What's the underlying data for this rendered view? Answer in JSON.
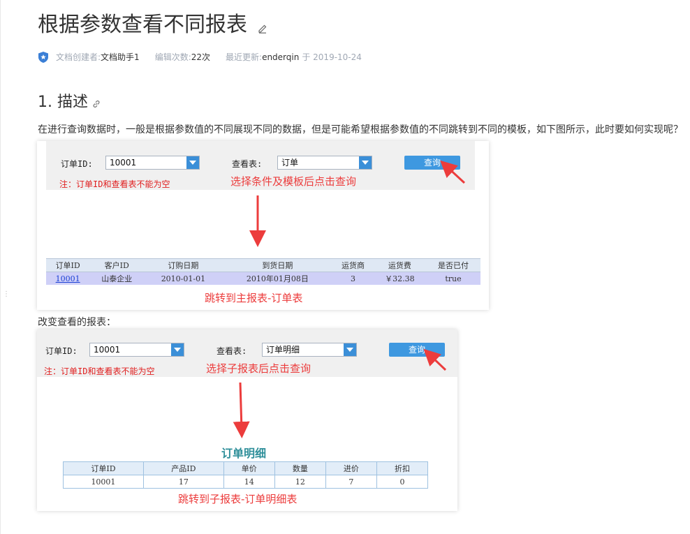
{
  "page": {
    "title": "根据参数查看不同报表",
    "meta": {
      "creator_label": "文档创建者:",
      "creator": "文档助手1",
      "edits_label": "编辑次数:",
      "edits": "22次",
      "updated_label": "最近更新:",
      "updated_by": "enderqin",
      "updated_on": "于 2019-10-24"
    },
    "section_title": "1. 描述",
    "description": "在进行查询数据时，一般是根据参数值的不同展现不同的数据，但是可能希望根据参数值的不同跳转到不同的模板，如下图所示，此时要如何实现呢？",
    "change_text": "改变查看的报表："
  },
  "shot1": {
    "order_label": "订单ID:",
    "order_value": "10001",
    "view_label": "查看表:",
    "view_value": "订单",
    "query_button": "查询",
    "note": "注：订单ID和查看表不能为空",
    "annotation_top": "选择条件及模板后点击查询",
    "annotation_bottom": "跳转到主报表-订单表",
    "table": {
      "headers": [
        "订单ID",
        "客户ID",
        "订购日期",
        "到货日期",
        "运货商",
        "运货费",
        "是否已付"
      ],
      "row": [
        "10001",
        "山泰企业",
        "2010-01-01",
        "2010年01月08日",
        "3",
        "￥32.38",
        "true"
      ]
    }
  },
  "shot2": {
    "order_label": "订单ID:",
    "order_value": "10001",
    "view_label": "查看表:",
    "view_value": "订单明细",
    "query_button": "查询",
    "note": "注：订单ID和查看表不能为空",
    "annotation_top": "选择子报表后点击查询",
    "report_title": "订单明细",
    "annotation_bottom": "跳转到子报表-订单明细表",
    "table": {
      "headers": [
        "订单ID",
        "产品ID",
        "单价",
        "数量",
        "进价",
        "折扣"
      ],
      "row": [
        "10001",
        "17",
        "14",
        "12",
        "7",
        "0"
      ]
    }
  },
  "colors": {
    "accent": "#3e98e0",
    "annotation": "#ec3c3c",
    "note": "#e02020",
    "title_teal": "#2f8f9a"
  }
}
